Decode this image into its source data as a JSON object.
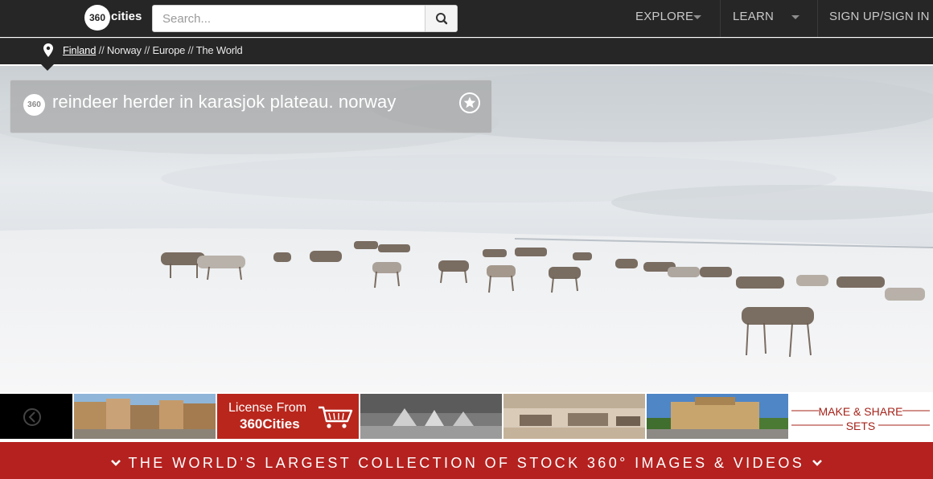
{
  "header": {
    "logo_text": "360",
    "logo_word": "cities",
    "search_placeholder": "Search...",
    "nav": [
      {
        "label": "EXPLORE"
      },
      {
        "label": "LEARN"
      },
      {
        "label": "SIGN UP/SIGN IN"
      }
    ]
  },
  "breadcrumb": {
    "items": [
      "Finland",
      "Norway",
      "Europe",
      "The World"
    ],
    "separator": "//"
  },
  "panorama": {
    "badge": "360",
    "title": "reindeer herder in karasjok plateau. norway"
  },
  "filmstrip": {
    "license_line1": "License From",
    "license_line2": "360Cities",
    "make_share_line1": "MAKE & SHARE",
    "make_share_line2": "SETS"
  },
  "banner": {
    "text": "THE WORLD’S LARGEST COLLECTION OF STOCK 360° IMAGES & VIDEOS"
  },
  "colors": {
    "topbar": "#262626",
    "accent_red": "#b9261c",
    "banner_red": "#b4211f"
  }
}
